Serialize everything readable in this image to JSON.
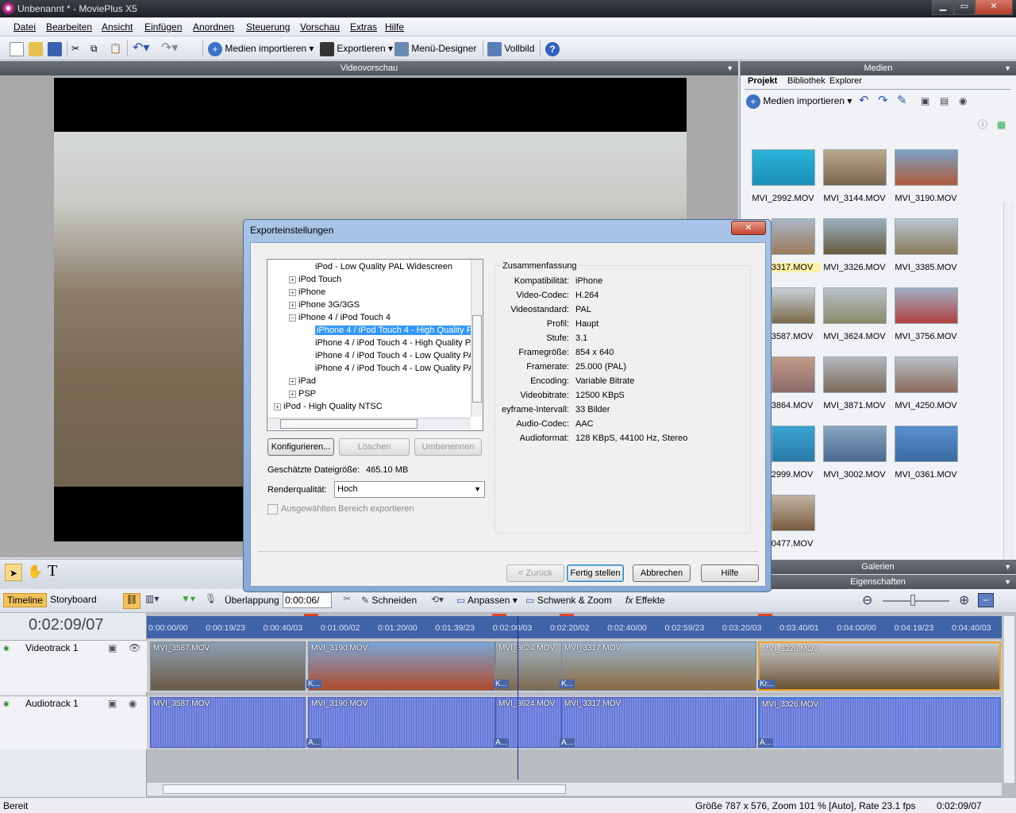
{
  "window": {
    "title": "Unbenannt * - MoviePlus X5",
    "min": "▁",
    "max": "▭",
    "close": "✕"
  },
  "menu": [
    "Datei",
    "Bearbeiten",
    "Ansicht",
    "Einfügen",
    "Anordnen",
    "Steuerung",
    "Vorschau",
    "Extras",
    "Hilfe"
  ],
  "toolbar": {
    "import": "Medien importieren",
    "export": "Exportieren",
    "menu_designer": "Menü-Designer",
    "fullscreen": "Vollbild"
  },
  "preview": {
    "title": "Videovorschau"
  },
  "media": {
    "title": "Medien",
    "tabs": [
      "Projekt",
      "Bibliothek",
      "Explorer"
    ],
    "import": "Medien importieren",
    "items": [
      "MVI_2992.MOV",
      "MVI_3144.MOV",
      "MVI_3190.MOV",
      "3317.MOV",
      "MVI_3326.MOV",
      "MVI_3385.MOV",
      "3587.MOV",
      "MVI_3624.MOV",
      "MVI_3756.MOV",
      "3864.MOV",
      "MVI_3871.MOV",
      "MVI_4250.MOV",
      "2999.MOV",
      "MVI_3002.MOV",
      "MVI_0361.MOV",
      "0477.MOV"
    ],
    "galleries": "Galerien",
    "properties": "Eigenschaften"
  },
  "timeline": {
    "tabs": [
      "Timeline",
      "Storyboard"
    ],
    "overlap_label": "Überlappung",
    "overlap_value": "0:00:06/",
    "cut": "Schneiden",
    "fit": "Anpassen",
    "panzoom": "Schwenk & Zoom",
    "effects": "Effekte",
    "time": "0:02:09/07",
    "ruler": [
      "0:00:00/00",
      "0:00:19/23",
      "0:00:40/03",
      "0:01:00/02",
      "0:01:20/00",
      "0:01:39/23",
      "0:02:00/03",
      "0:02:20/02",
      "0:02:40/00",
      "0:02:59/23",
      "0:03:20/03",
      "0:03:40/01",
      "0:04:00/00",
      "0:04:19/23",
      "0:04:40/03"
    ],
    "video_track": "Videotrack 1",
    "audio_track": "Audiotrack 1",
    "video_clips": [
      "MVI_3587.MOV",
      "MVI_3190.MOV",
      "MVI_3624.MOV",
      "MVI_3317.MOV",
      "MVI_3326.MOV"
    ],
    "audio_clips": [
      "MVI_3587.MOV",
      "MVI_3190.MOV",
      "MVI_3624.MOV",
      "MVI_3317.MOV",
      "MVI_3326.MOV"
    ],
    "transition_k": "K...",
    "transition_kr": "Kr...",
    "transition_a": "A..."
  },
  "dialog": {
    "title": "Exporteinstellungen",
    "tree": [
      {
        "label": "iPod - Low Quality PAL Widescreen",
        "level": 2,
        "toggle": ""
      },
      {
        "label": "iPod Touch",
        "level": 1,
        "toggle": "+"
      },
      {
        "label": "iPhone",
        "level": 1,
        "toggle": "+"
      },
      {
        "label": "iPhone 3G/3GS",
        "level": 1,
        "toggle": "+"
      },
      {
        "label": "iPhone 4 / iPod Touch 4",
        "level": 1,
        "toggle": "−"
      },
      {
        "label": "iPhone 4 / iPod Touch 4 - High Quality P.",
        "level": 2,
        "toggle": "",
        "selected": true
      },
      {
        "label": "iPhone 4 / iPod Touch 4 - High Quality P.",
        "level": 2,
        "toggle": ""
      },
      {
        "label": "iPhone 4 / iPod Touch 4 - Low Quality PA",
        "level": 2,
        "toggle": ""
      },
      {
        "label": "iPhone 4 / iPod Touch 4 - Low Quality PA",
        "level": 2,
        "toggle": ""
      },
      {
        "label": "iPad",
        "level": 1,
        "toggle": "+"
      },
      {
        "label": "PSP",
        "level": 1,
        "toggle": "+"
      },
      {
        "label": "iPod - High Quality NTSC",
        "level": 0,
        "toggle": "+"
      }
    ],
    "configure": "Konfigurieren...",
    "delete": "Löschen",
    "rename": "Umbenennen",
    "filesize_label": "Geschätzte Dateigröße:",
    "filesize_value": "465.10 MB",
    "quality_label": "Renderqualität:",
    "quality_value": "Hoch",
    "export_selection": "Ausgewählten Bereich exportieren",
    "summary_title": "Zusammenfassung",
    "summary": [
      {
        "k": "Kompatibilität:",
        "v": "iPhone"
      },
      {
        "k": "Video-Codec:",
        "v": "H.264"
      },
      {
        "k": "Videostandard:",
        "v": "PAL"
      },
      {
        "k": "Profil:",
        "v": "Haupt"
      },
      {
        "k": "Stufe:",
        "v": "3.1"
      },
      {
        "k": "Framegröße:",
        "v": "854 x 640"
      },
      {
        "k": "Framerate:",
        "v": "25.000 (PAL)"
      },
      {
        "k": "Encoding:",
        "v": "Variable Bitrate"
      },
      {
        "k": "Videobitrate:",
        "v": "12500 KBpS"
      },
      {
        "k": "eyframe-Intervall:",
        "v": "33 Bilder"
      },
      {
        "k": "Audio-Codec:",
        "v": "AAC"
      },
      {
        "k": "Audioformat:",
        "v": "128 KBpS, 44100 Hz, Stereo"
      }
    ],
    "back": "< Zurück",
    "finish": "Fertig stellen",
    "cancel": "Abbrechen",
    "help": "Hilfe"
  },
  "status": {
    "left": "Bereit",
    "info": "Größe 787 x 576, Zoom 101 % [Auto], Rate 23.1 fps",
    "time": "0:02:09/07"
  }
}
